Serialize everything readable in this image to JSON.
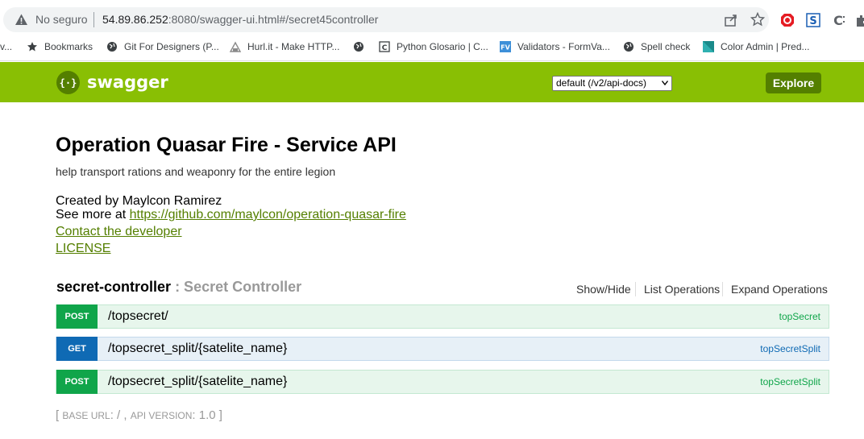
{
  "browser": {
    "security_label": "No seguro",
    "url_host": "54.89.86.252",
    "url_rest": ":8080/swagger-ui.html#/secret45controller",
    "bookmarks": [
      {
        "label": "v..."
      },
      {
        "label": "Bookmarks"
      },
      {
        "label": "Git For Designers (P..."
      },
      {
        "label": "Hurl.it - Make HTTP..."
      },
      {
        "label": ""
      },
      {
        "label": "Python Glosario | C..."
      },
      {
        "label": "Validators - FormVa..."
      },
      {
        "label": "Spell check"
      },
      {
        "label": "Color Admin | Pred..."
      }
    ]
  },
  "header": {
    "logo_text": "swagger",
    "api_select": "default (/v2/api-docs)",
    "explore_label": "Explore",
    "brand_color": "#89bf04",
    "dark_color": "#547f00"
  },
  "info": {
    "title": "Operation Quasar Fire - Service API",
    "description": "help transport rations and weaponry for the entire legion",
    "created_by": "Created by Maylcon Ramirez",
    "see_more_prefix": "See more at ",
    "see_more_link": "https://github.com/maylcon/operation-quasar-fire",
    "contact": "Contact the developer",
    "license": "LICENSE"
  },
  "resource": {
    "name": "secret-controller",
    "description": " : Secret Controller",
    "show_hide": "Show/Hide",
    "list_operations": "List Operations",
    "expand_operations": "Expand Operations",
    "operations": [
      {
        "method": "POST",
        "path": "/topsecret/",
        "nickname": "topSecret"
      },
      {
        "method": "GET",
        "path": "/topsecret_split/{satelite_name}",
        "nickname": "topSecretSplit"
      },
      {
        "method": "POST",
        "path": "/topsecret_split/{satelite_name}",
        "nickname": "topSecretSplit"
      }
    ]
  },
  "footer": {
    "open": "[ ",
    "base_url_label": "BASE URL",
    "base_url_value": ": / , ",
    "api_version_label": "API VERSION",
    "api_version_value": ": 1.0 ",
    "close": "]"
  }
}
